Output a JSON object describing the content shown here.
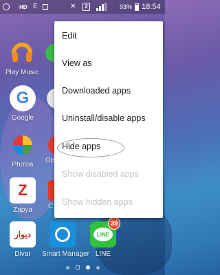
{
  "status_bar": {
    "network_type": "HD",
    "signal_mode": "E",
    "sim_slot": "2",
    "battery": "93%",
    "time": "18:54"
  },
  "apps": {
    "play_music": "Play Music",
    "google": "Google",
    "photos": "Photos",
    "zapya": "Zapya",
    "divar": "Divar",
    "divar_logo_text": "دیوار",
    "smart_manager": "Smart Manager",
    "line": "LINE",
    "line_badge": "39",
    "google_glyph": "G",
    "zapya_glyph": "Z",
    "line_glyph": "LINE"
  },
  "partial_labels": {
    "row3": "Op",
    "row4": "C"
  },
  "menu": {
    "items": [
      {
        "label": "Edit",
        "enabled": true
      },
      {
        "label": "View as",
        "enabled": true
      },
      {
        "label": "Downloaded apps",
        "enabled": true
      },
      {
        "label": "Uninstall/disable apps",
        "enabled": true
      },
      {
        "label": "Hide apps",
        "enabled": true,
        "circled": true
      },
      {
        "label": "Show disabled apps",
        "enabled": false
      },
      {
        "label": "Show hidden apps",
        "enabled": false
      }
    ]
  },
  "pager": {
    "pages": 3,
    "active_page": 2
  }
}
